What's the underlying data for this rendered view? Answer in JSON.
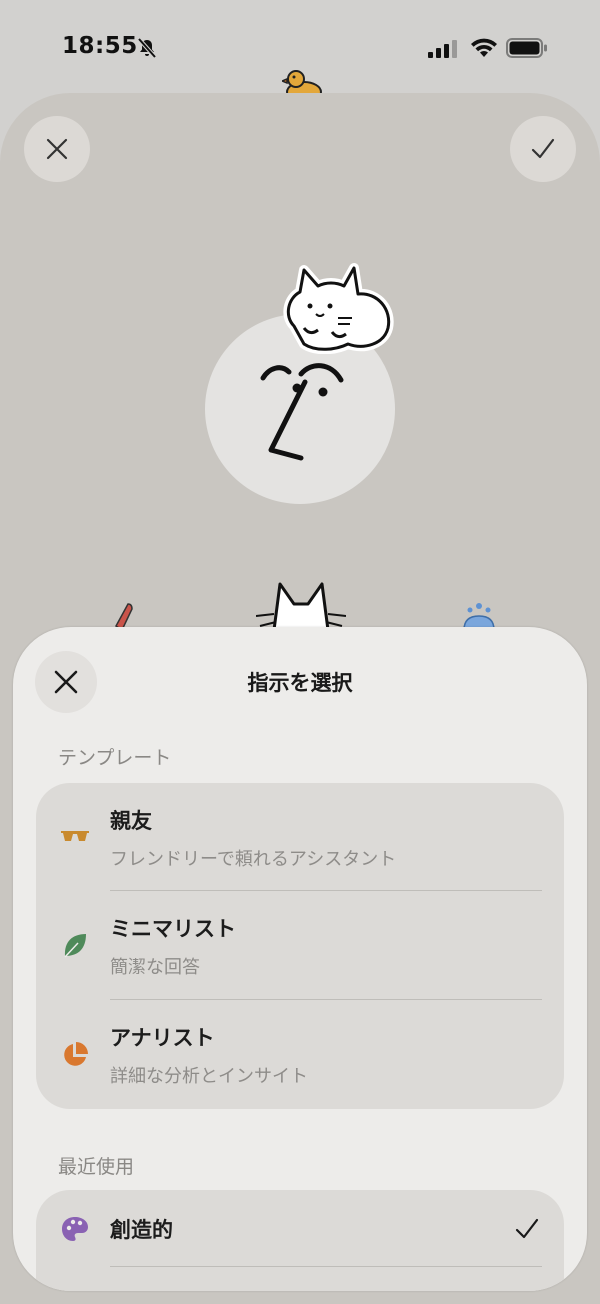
{
  "status_bar": {
    "time": "18:55",
    "icons": [
      "bell-slash-icon",
      "signal-icon",
      "wifi-icon",
      "battery-icon"
    ]
  },
  "background_screen": {
    "icons": [
      "close-icon",
      "checkmark-icon",
      "duck-sticker-icon",
      "cat-sticker-icon",
      "face-avatar-icon"
    ]
  },
  "sheet": {
    "title": "指示を選択",
    "close_icon": "close-icon",
    "templates": {
      "label": "テンプレート",
      "items": [
        {
          "title": "親友",
          "subtitle": "フレンドリーで頼れるアシスタント",
          "icon": "sunglasses-icon",
          "icon_color": "#c98a2e"
        },
        {
          "title": "ミニマリスト",
          "subtitle": "簡潔な回答",
          "icon": "leaf-icon",
          "icon_color": "#4f8a5a"
        },
        {
          "title": "アナリスト",
          "subtitle": "詳細な分析とインサイト",
          "icon": "pie-chart-icon",
          "icon_color": "#d9782f"
        }
      ]
    },
    "recent": {
      "label": "最近使用",
      "items": [
        {
          "title": "創造的",
          "icon": "palette-icon",
          "icon_color": "#8a62b3",
          "selected": true
        }
      ]
    }
  }
}
